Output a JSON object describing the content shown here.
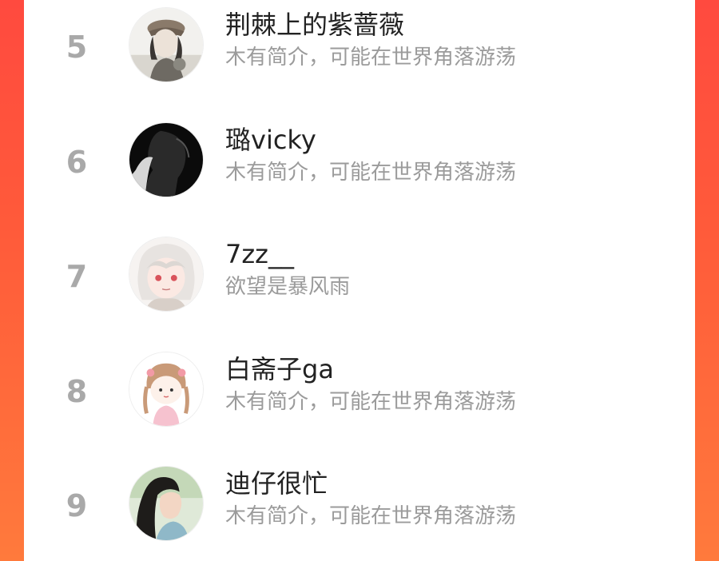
{
  "colors": {
    "background_gradient_top": "#ff4a3f",
    "background_gradient_bottom": "#ff7a3c",
    "panel": "#ffffff",
    "rank_text": "#a9a9a9",
    "name_text": "#222222",
    "bio_text": "#9b9b9b"
  },
  "list": {
    "items": [
      {
        "rank": "5",
        "name": "荆棘上的紫蔷薇",
        "bio": "木有简介，可能在世界角落游荡",
        "avatar": "avatar-girl-cap-icon"
      },
      {
        "rank": "6",
        "name": "璐vicky",
        "bio": "木有简介，可能在世界角落游荡",
        "avatar": "avatar-silhouette-icon"
      },
      {
        "rank": "7",
        "name": "7zz__",
        "bio": "欲望是暴风雨",
        "avatar": "avatar-anime-white-hair-icon"
      },
      {
        "rank": "8",
        "name": "白斋子ga",
        "bio": "木有简介，可能在世界角落游荡",
        "avatar": "avatar-cartoon-girl-icon"
      },
      {
        "rank": "9",
        "name": "迪仔很忙",
        "bio": "木有简介，可能在世界角落游荡",
        "avatar": "avatar-woman-profile-icon"
      }
    ]
  }
}
